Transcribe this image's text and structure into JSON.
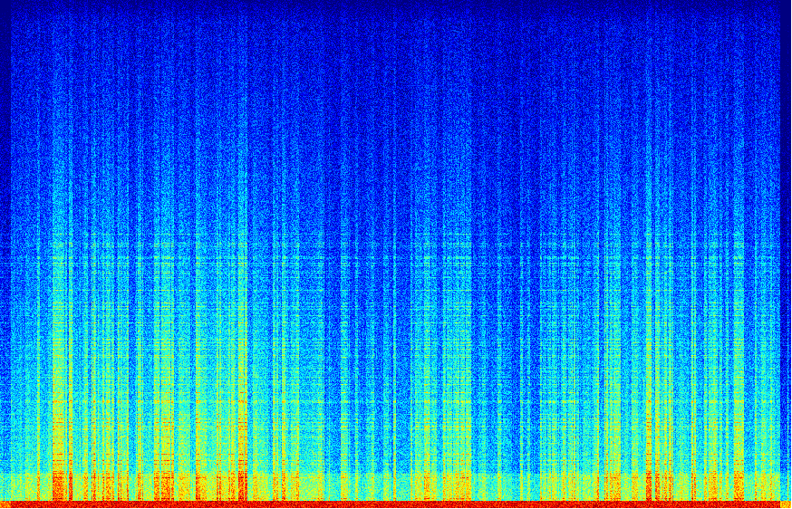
{
  "image": {
    "subject": "spectrogram",
    "colormap": "jet",
    "colors": {
      "low": "#000080",
      "mid_low": "#0040ff",
      "mid": "#00d0ff",
      "mid_high": "#60ff40",
      "high": "#ffff00",
      "peak": "#ff4000",
      "border": "#ffffff"
    }
  }
}
